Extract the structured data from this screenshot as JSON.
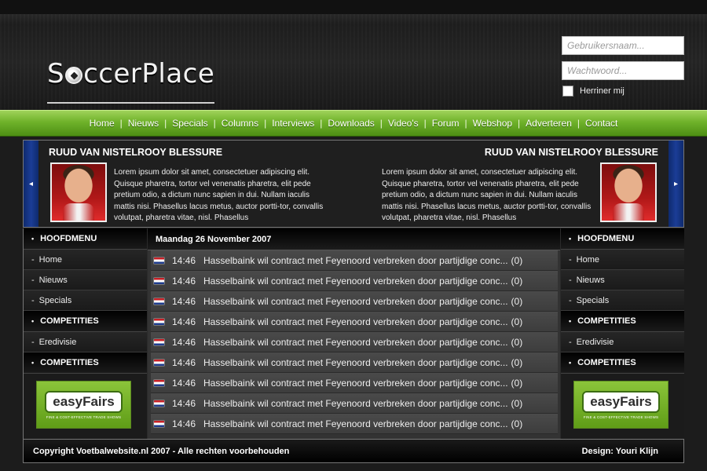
{
  "header": {
    "logo_prefix": "S",
    "logo_suffix": "ccerPlace",
    "username_placeholder": "Gebruikersnaam...",
    "password_placeholder": "Wachtwoord...",
    "remember_label": "Herriner mij"
  },
  "nav": {
    "items": [
      "Home",
      "Nieuws",
      "Specials",
      "Columns",
      "Interviews",
      "Downloads",
      "Video's",
      "Forum",
      "Webshop",
      "Adverteren",
      "Contact"
    ],
    "separator": "|"
  },
  "feature": {
    "prev_icon": "◂",
    "next_icon": "▸",
    "left": {
      "title": "RUUD VAN NISTELROOY BLESSURE",
      "text": "Lorem ipsum dolor sit amet, consectetuer adipiscing elit. Quisque pharetra, tortor vel venenatis pharetra, elit pede pretium odio, a dictum nunc sapien in dui. Nullam iaculis mattis nisi. Phasellus lacus metus, auctor portti-tor, convallis volutpat, pharetra vitae, nisl. Phasellus"
    },
    "right": {
      "title": "RUUD VAN NISTELROOY BLESSURE",
      "text": "Lorem ipsum dolor sit amet, consectetuer adipiscing elit. Quisque pharetra, tortor vel venenatis pharetra, elit pede pretium odio, a dictum nunc sapien in dui. Nullam iaculis mattis nisi. Phasellus lacus metus, auctor portti-tor, convallis volutpat, pharetra vitae, nisl. Phasellus"
    }
  },
  "left_sidebar": {
    "menu_head": "HOOFDMENU",
    "menu_items": [
      "Home",
      "Nieuws",
      "Specials"
    ],
    "comp_head": "COMPETITIES",
    "comp_items": [
      "Eredivisie"
    ],
    "comp_head2": "COMPETITIES",
    "ad_brand": "easyFairs",
    "ad_tag": "FINE & COST-EFFECTIVE TRADE SHOWS"
  },
  "right_sidebar": {
    "menu_head": "HOOFDMENU",
    "menu_items": [
      "Home",
      "Nieuws",
      "Specials"
    ],
    "comp_head": "COMPETITIES",
    "comp_items": [
      "Eredivisie"
    ],
    "comp_head2": "COMPETITIES",
    "ad_brand": "easyFairs",
    "ad_tag": "FINE & COST-EFFECTIVE TRADE SHOWS"
  },
  "news": {
    "date": "Maandag 26 November 2007",
    "items": [
      {
        "time": "14:46",
        "title": "Hasselbaink wil contract met Feyenoord verbreken door partijdige conc...",
        "count": "(0)"
      },
      {
        "time": "14:46",
        "title": "Hasselbaink wil contract met Feyenoord verbreken door partijdige conc...",
        "count": "(0)"
      },
      {
        "time": "14:46",
        "title": "Hasselbaink wil contract met Feyenoord verbreken door partijdige conc...",
        "count": "(0)"
      },
      {
        "time": "14:46",
        "title": "Hasselbaink wil contract met Feyenoord verbreken door partijdige conc...",
        "count": "(0)"
      },
      {
        "time": "14:46",
        "title": "Hasselbaink wil contract met Feyenoord verbreken door partijdige conc...",
        "count": "(0)"
      },
      {
        "time": "14:46",
        "title": "Hasselbaink wil contract met Feyenoord verbreken door partijdige conc...",
        "count": "(0)"
      },
      {
        "time": "14:46",
        "title": "Hasselbaink wil contract met Feyenoord verbreken door partijdige conc...",
        "count": "(0)"
      },
      {
        "time": "14:46",
        "title": "Hasselbaink wil contract met Feyenoord verbreken door partijdige conc...",
        "count": "(0)"
      },
      {
        "time": "14:46",
        "title": "Hasselbaink wil contract met Feyenoord verbreken door partijdige conc...",
        "count": "(0)"
      }
    ]
  },
  "footer": {
    "copyright": "Copyright Voetbalwebsite.nl 2007 - Alle rechten voorbehouden",
    "design": "Design: Youri Klijn"
  },
  "colors": {
    "nav_green": "#6fb22a",
    "feature_arrow_blue": "#1b3d96",
    "background": "#1c1c1c"
  }
}
